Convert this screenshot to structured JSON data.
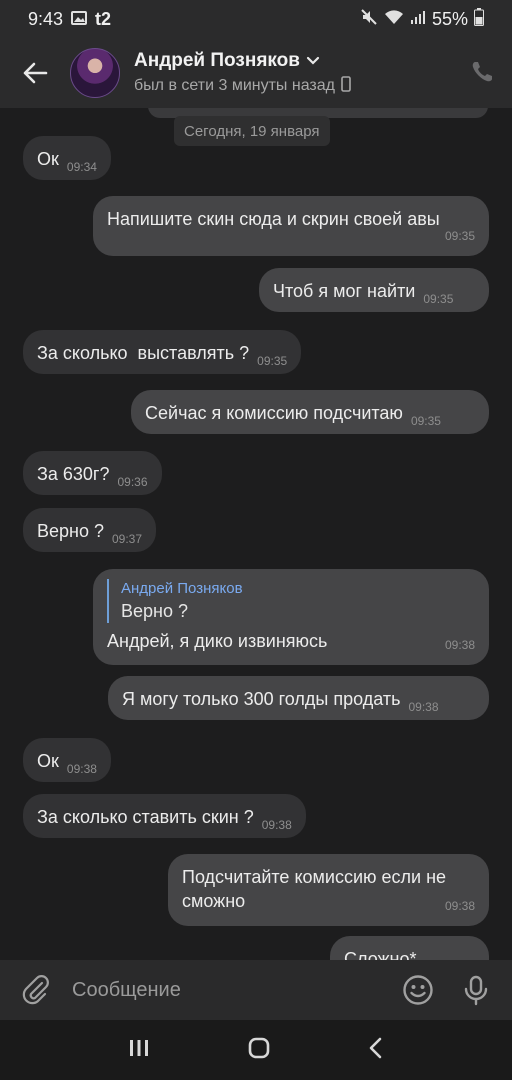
{
  "status_bar": {
    "time": "9:43",
    "carrier": "t2",
    "battery": "55%",
    "icons": [
      "gallery-icon",
      "mute-icon",
      "wifi-icon",
      "signal-icon",
      "battery-icon"
    ]
  },
  "header": {
    "name": "Андрей Позняков",
    "status": "был в сети 3 минуты назад",
    "icons": [
      "back-arrow-icon",
      "chevron-down-icon",
      "mobile-icon",
      "phone-icon"
    ]
  },
  "chat": {
    "date_separator": "Сегодня, 19 января",
    "messages": [
      {
        "dir": "in",
        "text": "Ок",
        "time": "09:34"
      },
      {
        "dir": "out",
        "text": "Напишите скин сюда и скрин своей авы",
        "time": "09:35"
      },
      {
        "dir": "out",
        "text": "Чтоб я мог найти",
        "time": "09:35"
      },
      {
        "dir": "in",
        "text": "За сколько  выставлять ?",
        "time": "09:35"
      },
      {
        "dir": "out",
        "text": "Сейчас я комиссию подсчитаю",
        "time": "09:35"
      },
      {
        "dir": "in",
        "text": "За 630г?",
        "time": "09:36"
      },
      {
        "dir": "in",
        "text": "Верно ?",
        "time": "09:37"
      },
      {
        "dir": "out",
        "reply_name": "Андрей Позняков",
        "reply_text": "Верно ?",
        "text": "Андрей, я дико извиняюсь",
        "time": "09:38"
      },
      {
        "dir": "out",
        "text": "Я могу только 300 голды продать",
        "time": "09:38"
      },
      {
        "dir": "in",
        "text": "Ок",
        "time": "09:38"
      },
      {
        "dir": "in",
        "text": "За сколько ставить скин ?",
        "time": "09:38"
      },
      {
        "dir": "out",
        "text": "Подсчитайте комиссию если не сможно",
        "time": "09:38"
      },
      {
        "dir": "out",
        "text": "Сложно*",
        "time": ""
      }
    ]
  },
  "input": {
    "placeholder": "Сообщение",
    "icons": [
      "paperclip-icon",
      "emoji-icon",
      "mic-icon"
    ]
  },
  "nav": {
    "icons": [
      "recents-icon",
      "home-icon",
      "back-icon"
    ]
  },
  "colors": {
    "background": "#1d1d1e",
    "incoming_bubble": "#323234",
    "outgoing_bubble": "#454547",
    "reply_accent": "#7aaaf0"
  }
}
